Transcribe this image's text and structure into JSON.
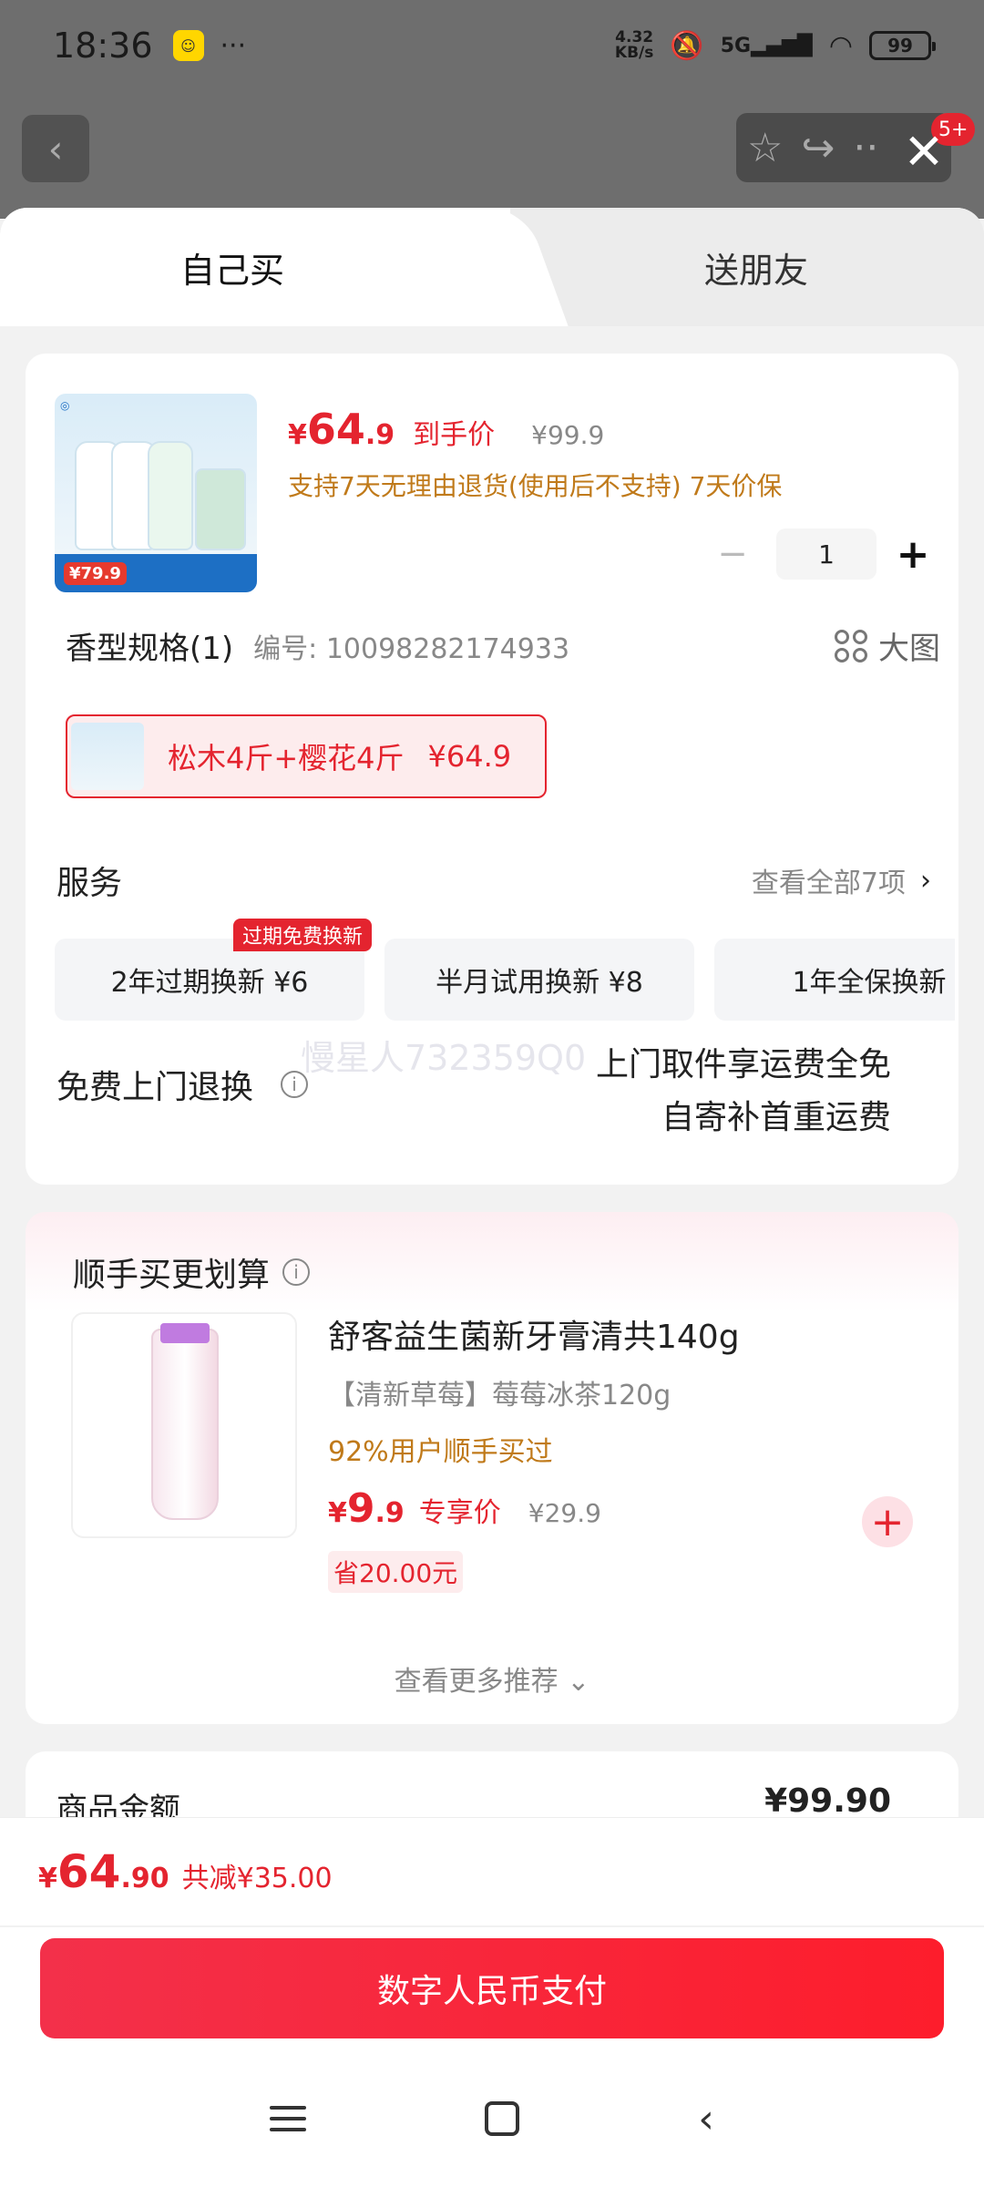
{
  "status_bar": {
    "time": "18:36",
    "app_badge": "闲鱼",
    "dots": "···",
    "net_speed_top": "4.32",
    "net_speed_bottom": "KB/s",
    "network": "5G",
    "battery": "99"
  },
  "top_nav": {
    "back_icon": "chevron-left-icon",
    "badge": "5+",
    "close_icon": "close-icon"
  },
  "tabs": [
    {
      "label": "自己买",
      "active": true
    },
    {
      "label": "送朋友",
      "active": false
    }
  ],
  "product": {
    "image_banner_price": "¥79.9",
    "price_symbol": "¥",
    "price_int": "64",
    "price_dec": ".9",
    "price_tag": "到手价",
    "original_price": "¥99.9",
    "service_line": "支持7天无理由退货(使用后不支持) 7天价保",
    "quantity": "1"
  },
  "spec": {
    "title": "香型规格(1)",
    "number": "编号: 10098282174933",
    "big_image": "大图",
    "selected_label": "松木4斤+樱花4斤",
    "selected_price": "¥64.9"
  },
  "services": {
    "title": "服务",
    "view_all": "查看全部7项",
    "badge": "过期免费换新",
    "items": [
      "2年过期换新  ¥6",
      "半月试用换新  ¥8",
      "1年全保换新"
    ]
  },
  "watermark": "慢星人732359Q0",
  "free_return": {
    "title": "免费上门退换",
    "line1": "上门取件享运费全免",
    "line2": "自寄补首重运费"
  },
  "recommend": {
    "title": "顺手买更划算",
    "name": "舒客益生菌新牙膏清共140g",
    "sku": "【清新草莓】莓莓冰茶120g",
    "bought": "92%用户顺手买过",
    "price_symbol": "¥",
    "price_int": "9",
    "price_dec": ".9",
    "price_tag": "专享价",
    "original_price": "¥29.9",
    "save": "省20.00元",
    "more": "查看更多推荐 ⌄"
  },
  "amount": {
    "label": "商品金额",
    "value": "¥99.90"
  },
  "bottom": {
    "price_symbol": "¥",
    "price_int": "64",
    "price_dec": ".90",
    "reduce": "共减¥35.00",
    "pay_button": "数字人民币支付"
  },
  "colors": {
    "accent_red": "#e4242f",
    "service_orange": "#c07a1a"
  }
}
